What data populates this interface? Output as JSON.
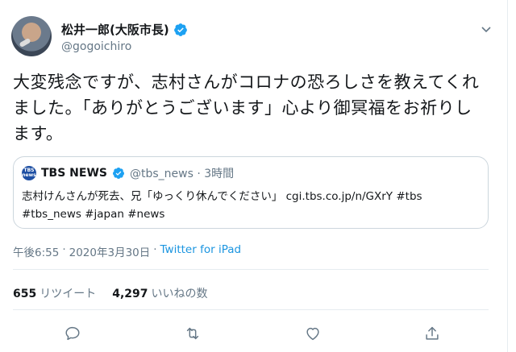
{
  "user": {
    "display_name": "松井一郎(大阪市長)",
    "handle": "@gogoichiro",
    "verified_color": "#1da1f2"
  },
  "tweet": {
    "text": "大変残念ですが、志村さんがコロナの恐ろしさを教えてくれました。「ありがとうございます」心より御冥福をお祈りします。"
  },
  "quote": {
    "logo_text": "TBS NEWS",
    "display_name": "TBS NEWS",
    "handle_time": "@tbs_news · 3時間",
    "text_line1": "志村けんさんが死去、兄「ゆっくり休んでください」 cgi.tbs.co.jp/n/GXrY #tbs",
    "text_line2": "#tbs_news #japan #news"
  },
  "meta": {
    "time": "午後6:55",
    "sep1": "·",
    "date": "2020年3月30日",
    "sep2": "·",
    "source": "Twitter for iPad"
  },
  "stats": {
    "retweets_count": "655",
    "retweets_label": "リツイート",
    "likes_count": "4,297",
    "likes_label": "いいねの数"
  },
  "actions": [
    "reply-icon",
    "retweet-icon",
    "like-icon",
    "share-icon"
  ],
  "colors": {
    "accent": "#1b95e0",
    "muted": "#657786",
    "border": "#e6ecf0"
  }
}
